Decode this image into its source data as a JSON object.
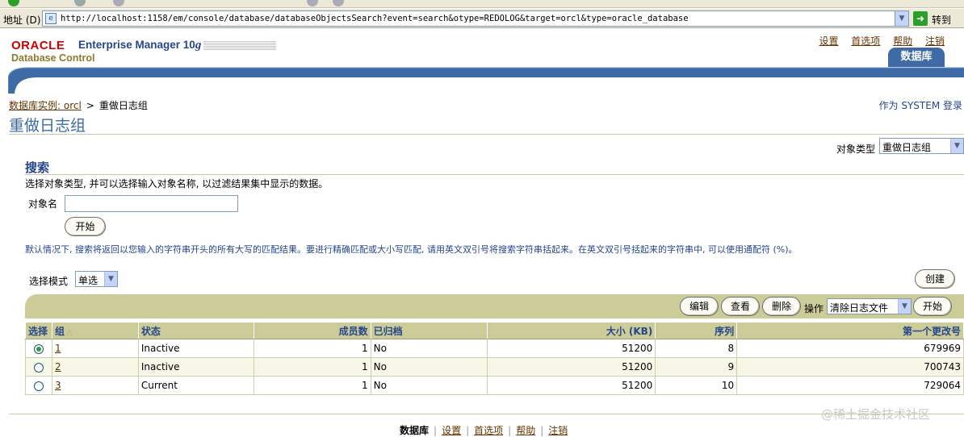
{
  "browser": {
    "address_label": "地址 (D)",
    "url": "http://localhost:1158/em/console/database/databaseObjectsSearch?event=search&otype=REDOLOG&target=orcl&type=oracle_database",
    "go_label": "转到"
  },
  "brand": {
    "oracle": "ORACLE",
    "product": "Enterprise Manager 10",
    "product_version": "g",
    "subtitle": "Database Control"
  },
  "global_links": [
    "设置",
    "首选项",
    "帮助",
    "注销"
  ],
  "tab": {
    "label": "数据库"
  },
  "breadcrumb": {
    "link": "数据库实例: orcl",
    "separator": ">",
    "current": "重做日志组"
  },
  "login_as": "作为 SYSTEM 登录",
  "page_title": "重做日志组",
  "object_type": {
    "label": "对象类型",
    "value": "重做日志组"
  },
  "search": {
    "heading": "搜索",
    "description": "选择对象类型, 并可以选择输入对象名称, 以过滤结果集中显示的数据。",
    "object_name_label": "对象名",
    "object_name_value": "",
    "start_button": "开始",
    "hint": "默认情况下, 搜索将返回以您输入的字符串开头的所有大写的匹配结果。要进行精确匹配或大小写匹配, 请用英文双引号将搜索字符串括起来。在英文双引号括起来的字符串中, 可以使用通配符 (%)。"
  },
  "selection_mode": {
    "label": "选择模式",
    "value": "单选"
  },
  "create_button": "创建",
  "actions": {
    "edit": "编辑",
    "view": "查看",
    "delete": "删除",
    "operation_label": "操作",
    "operation_value": "清除日志文件",
    "go": "开始"
  },
  "table": {
    "headers": {
      "select": "选择",
      "group": "组",
      "status": "状态",
      "members": "成员数",
      "archived": "已归档",
      "size": "大小 (KB)",
      "sequence": "序列",
      "first_change": "第一个更改号"
    },
    "rows": [
      {
        "selected": true,
        "group": "1",
        "status": "Inactive",
        "members": "1",
        "archived": "No",
        "size": "51200",
        "sequence": "8",
        "first_change": "679969"
      },
      {
        "selected": false,
        "group": "2",
        "status": "Inactive",
        "members": "1",
        "archived": "No",
        "size": "51200",
        "sequence": "9",
        "first_change": "700743"
      },
      {
        "selected": false,
        "group": "3",
        "status": "Current",
        "members": "1",
        "archived": "No",
        "size": "51200",
        "sequence": "10",
        "first_change": "729064"
      }
    ]
  },
  "footer": {
    "current": "数据库",
    "links": [
      "设置",
      "首选项",
      "帮助",
      "注销"
    ]
  },
  "watermark": "@稀土掘金技术社区",
  "colors": {
    "oracle_red": "#d20000",
    "em_blue": "#26468c",
    "title_blue": "#3b6aa6",
    "khaki": "#cccc99",
    "link_brown": "#663300"
  }
}
